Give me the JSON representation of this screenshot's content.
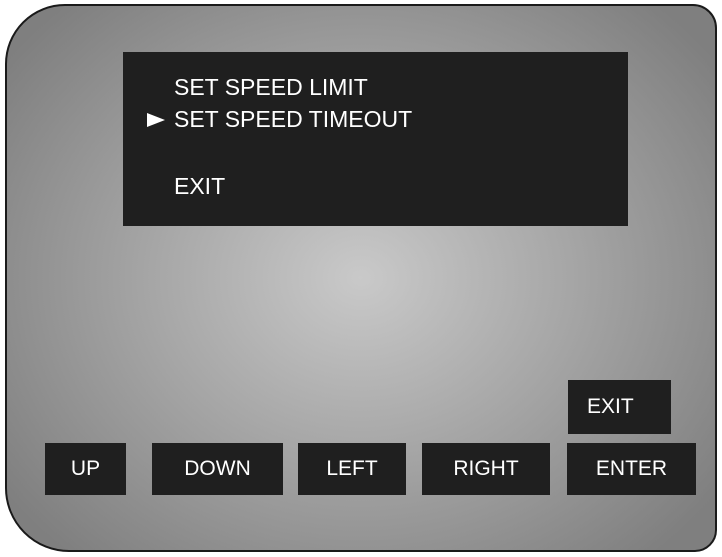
{
  "screen": {
    "menu_items": [
      {
        "label": "SET SPEED LIMIT",
        "selected": false
      },
      {
        "label": "SET SPEED TIMEOUT",
        "selected": true
      },
      {
        "label": "EXIT",
        "selected": false
      }
    ],
    "selector_icon": "right-triangle-pointer"
  },
  "keys": {
    "up": "UP",
    "down": "DOWN",
    "left": "LEFT",
    "right": "RIGHT",
    "enter": "ENTER",
    "exit": "EXIT"
  },
  "colors": {
    "screen_bg": "#1f1f1f",
    "text": "#ffffff",
    "device_light": "#c9c9c9",
    "device_dark": "#7f7f7f"
  }
}
